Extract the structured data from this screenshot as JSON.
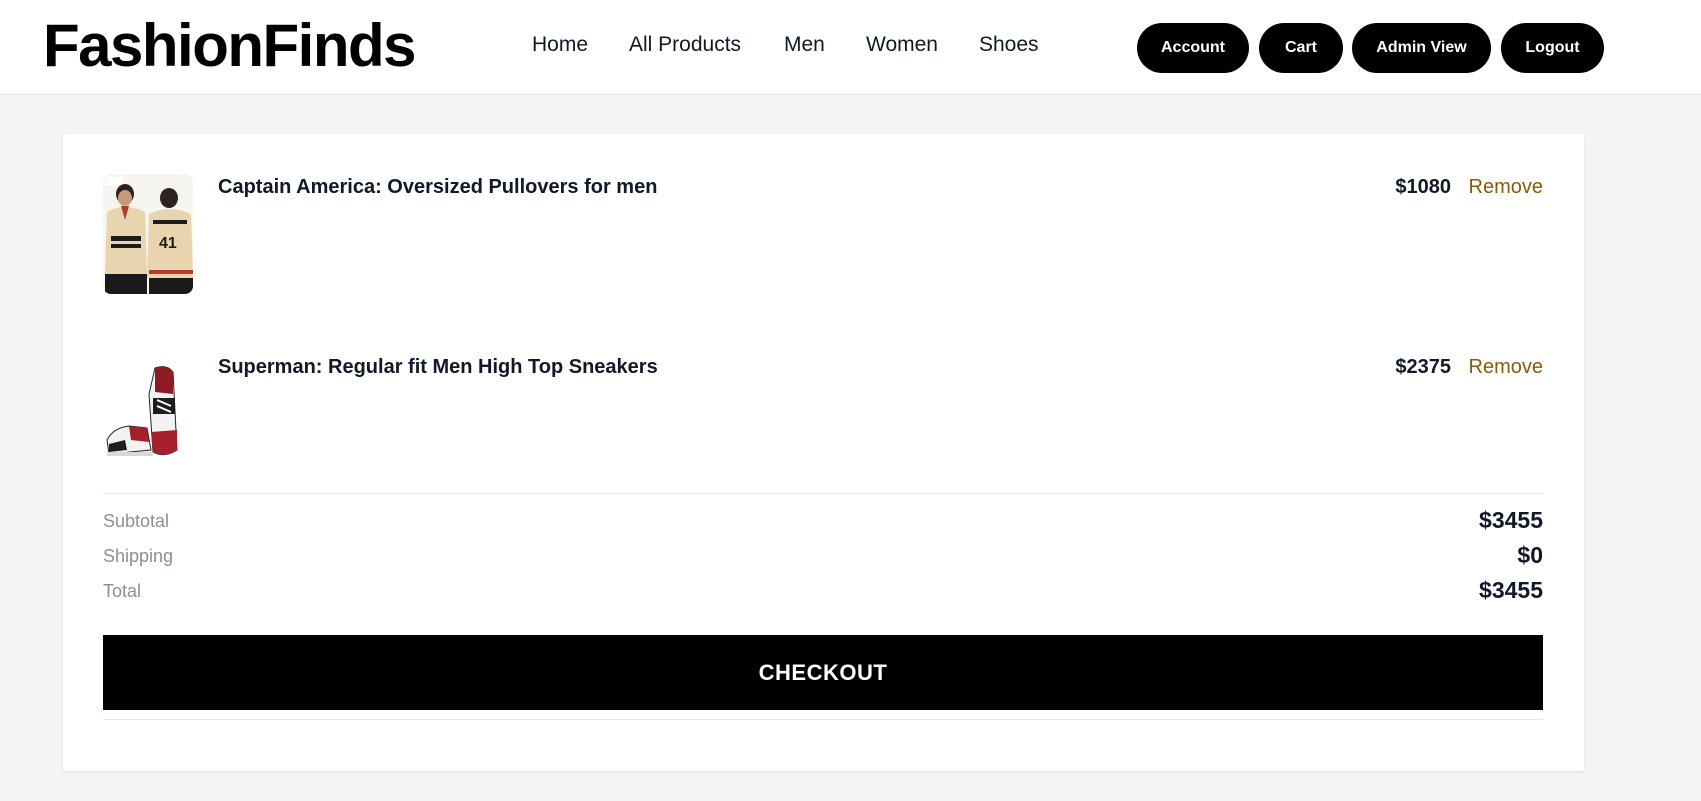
{
  "brand": {
    "name": "FashionFinds"
  },
  "nav": {
    "home": "Home",
    "all_products": "All Products",
    "men": "Men",
    "women": "Women",
    "shoes": "Shoes"
  },
  "actions": {
    "account": "Account",
    "cart": "Cart",
    "admin_view": "Admin View",
    "logout": "Logout"
  },
  "cart": {
    "items": [
      {
        "name": "Captain America: Oversized Pullovers for men",
        "price": "$1080",
        "remove_label": "Remove",
        "image_icon": "pullover-photo"
      },
      {
        "name": "Superman: Regular fit Men High Top Sneakers",
        "price": "$2375",
        "remove_label": "Remove",
        "image_icon": "sneaker-photo"
      }
    ],
    "summary": {
      "subtotal_label": "Subtotal",
      "subtotal_value": "$3455",
      "shipping_label": "Shipping",
      "shipping_value": "$0",
      "total_label": "Total",
      "total_value": "$3455"
    },
    "checkout_label": "CHECKOUT"
  },
  "colors": {
    "page_bg": "#f3f4f6",
    "accent_remove": "#8a5a0b",
    "button_bg": "#000000"
  }
}
